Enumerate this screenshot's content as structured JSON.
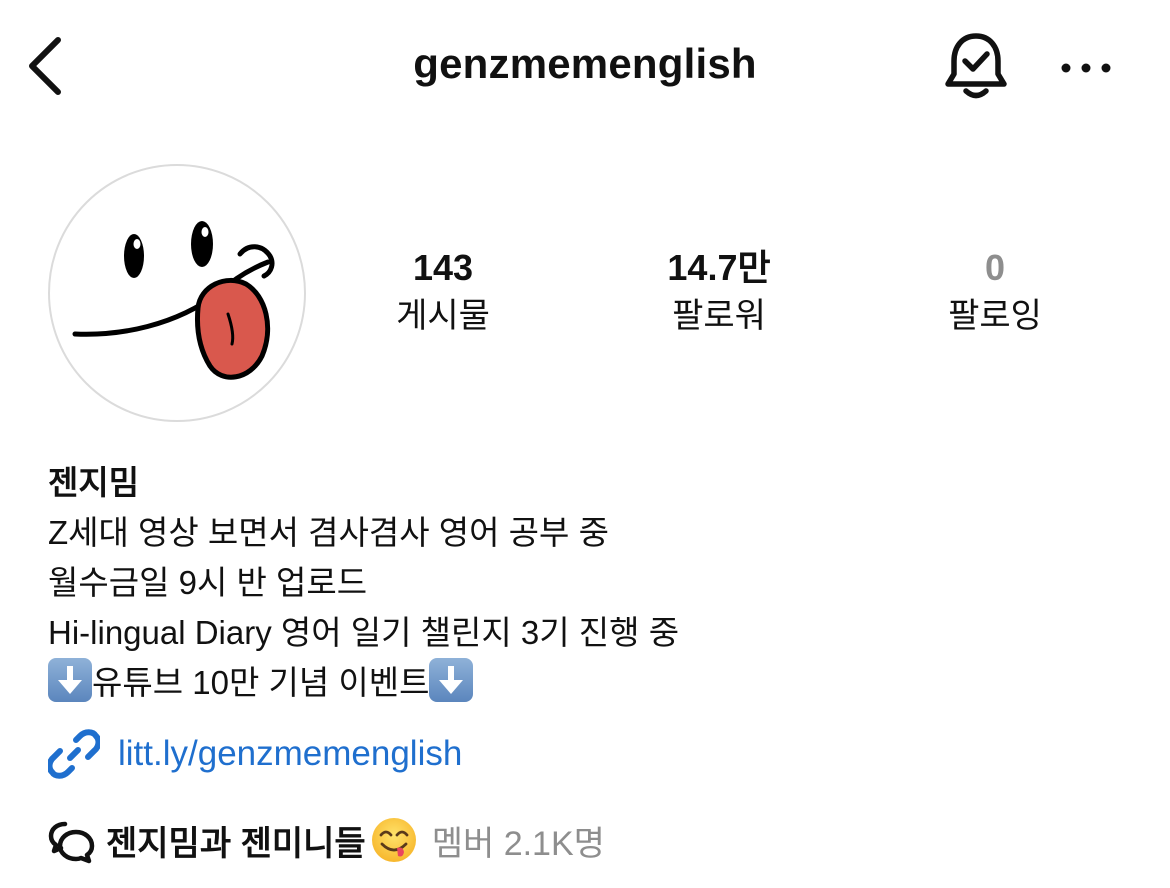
{
  "header": {
    "username": "genzmemenglish",
    "back_icon": "chevron-left-icon",
    "bell_icon": "bell-check-icon",
    "more_icon": "more-horizontal-icon"
  },
  "stats": {
    "posts": {
      "value": "143",
      "label": "게시물"
    },
    "followers": {
      "value": "14.7만",
      "label": "팔로워"
    },
    "following": {
      "value": "0",
      "label": "팔로잉"
    }
  },
  "bio": {
    "display_name": "젠지밈",
    "lines": [
      "Z세대 영상 보면서 겸사겸사 영어 공부 중",
      "월수금일 9시 반 업로드",
      "Hi-lingual Diary 영어 일기 챌린지 3기 진행 중"
    ],
    "event_text": "유튜브 10만 기념 이벤트",
    "event_icon": "down-arrow-box-icon"
  },
  "link": {
    "text": "litt.ly/genzmemenglish",
    "icon": "link-icon",
    "color": "#1f6fce"
  },
  "community": {
    "name": "젠지밈과 젠미니들",
    "members": "멤버 2.1K명",
    "icon": "chat-bubbles-icon",
    "emoji": "yum-face-emoji"
  },
  "colors": {
    "text": "#111111",
    "muted": "#8e8e8e",
    "link": "#1f6fce",
    "avatar_border": "#dbdbdb"
  }
}
